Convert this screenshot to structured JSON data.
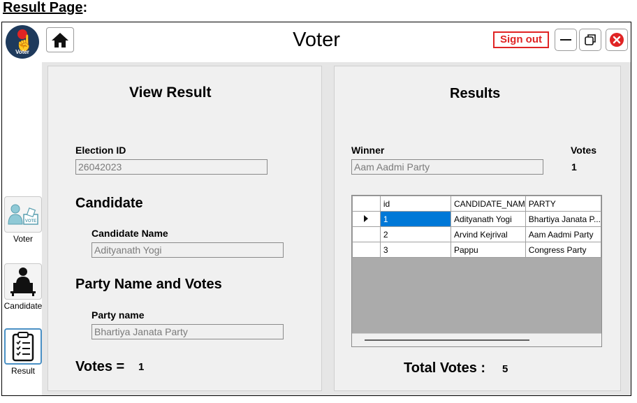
{
  "caption": {
    "label": "Result Page",
    "colon": ":"
  },
  "app": {
    "title": "Voter",
    "logo_text": "Voter",
    "signout_label": "Sign out"
  },
  "sidebar": {
    "items": [
      {
        "label": "Voter",
        "icon": "voter-icon"
      },
      {
        "label": "Candidate",
        "icon": "candidate-icon"
      },
      {
        "label": "Result",
        "icon": "clipboard-icon"
      }
    ]
  },
  "left_panel": {
    "title": "View Result",
    "election_id_label": "Election ID",
    "election_id_value": "26042023",
    "candidate_heading": "Candidate",
    "candidate_name_label": "Candidate Name",
    "candidate_name_value": "Adityanath Yogi",
    "party_heading": "Party Name and Votes",
    "party_name_label": "Party name",
    "party_name_value": "Bhartiya Janata Party",
    "votes_label": "Votes =",
    "votes_value": "1"
  },
  "right_panel": {
    "title": "Results",
    "winner_label": "Winner",
    "winner_value": "Aam Aadmi Party",
    "votes_label": "Votes",
    "votes_value": "1",
    "total_label": "Total Votes :",
    "total_value": "5",
    "grid": {
      "columns": [
        "id",
        "CANDIDATE_NAM",
        "PARTY"
      ],
      "rows": [
        [
          "1",
          "Adityanath Yogi",
          "Bhartiya Janata P..."
        ],
        [
          "2",
          "Arvind Kejrival",
          "Aam Aadmi Party"
        ],
        [
          "3",
          "Pappu",
          "Congress Party"
        ]
      ]
    }
  },
  "colors": {
    "accent_red": "#e02424",
    "selection_blue": "#0078d7",
    "logo_navy": "#1e3a5c"
  }
}
